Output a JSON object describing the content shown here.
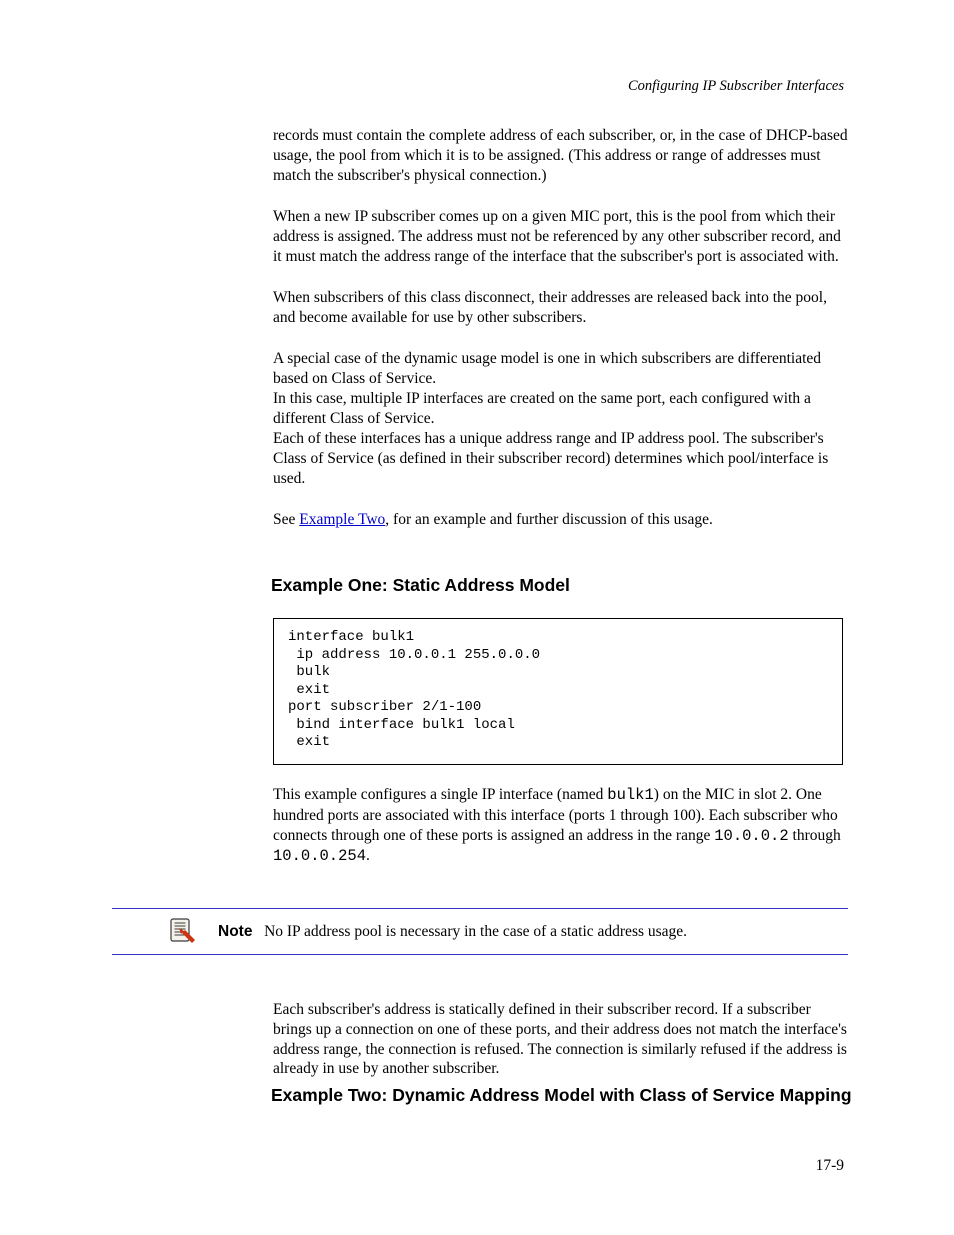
{
  "runningHeader": "Configuring IP Subscriber Interfaces",
  "para1": "records must contain the complete address of each subscriber, or, in the case of DHCP-based usage, the pool from which it is to be assigned. (This address or range of addresses must match the subscriber's physical connection.)",
  "para2": "When a new IP subscriber comes up on a given MIC port, this is the pool from which their address is assigned. The address must not be referenced by any other subscriber record, and it must match the address range of the interface that the subscriber's port is associated with.",
  "para3": "When subscribers of this class disconnect, their addresses are released back into the pool, and become available for use by other subscribers.",
  "para4": "A special case of the dynamic usage model is one in which subscribers are differentiated based on Class of Service.",
  "para4b": "In this case, multiple IP interfaces are created on the same port, each configured with a different Class of Service.",
  "para5": "Each of these interfaces has a unique address range and IP address pool. The subscriber's Class of Service (as defined in their subscriber record) determines which pool/interface is used.",
  "para6_prefix": "See ",
  "para6_link": "Example Two",
  "para6_suffix": ", for an example and further discussion of this usage.",
  "headingExample1": "Example One: Static Address Model",
  "code": {
    "l1": "interface bulk1",
    "l2": "ip address 10.0.0.1 255.0.0.0",
    "l3": "bulk",
    "l4": "exit",
    "l5": "port subscriber 2/1-100",
    "l6": "bind interface bulk1 local",
    "l7": "exit"
  },
  "para7_a": "This example configures a single IP interface (named ",
  "para7_b": "bulk1",
  "para7_c": ") on the MIC in slot 2. One hundred ports are associated with this interface (ports 1 through 100). Each subscriber who connects through one of these ports is assigned an address in the range ",
  "para7_d": "10.0.0.2",
  "para7_e": " through ",
  "para7_f": "10.0.0.254",
  "para7_g": ".",
  "noteLabel": "Note",
  "noteText": "No IP address pool is necessary in the case of a static address usage.",
  "para8_a": "Each subscriber's address is statically defined in their subscriber record. If a subscriber brings up a connection on one of these ports, and their address does not match the interface's address range, the connection is refused. The connection is similarly refused if the address is already in use by another subscriber.",
  "headingExample2": "Example Two: Dynamic Address Model with Class of Service Mapping",
  "pageNumber": "17-9"
}
